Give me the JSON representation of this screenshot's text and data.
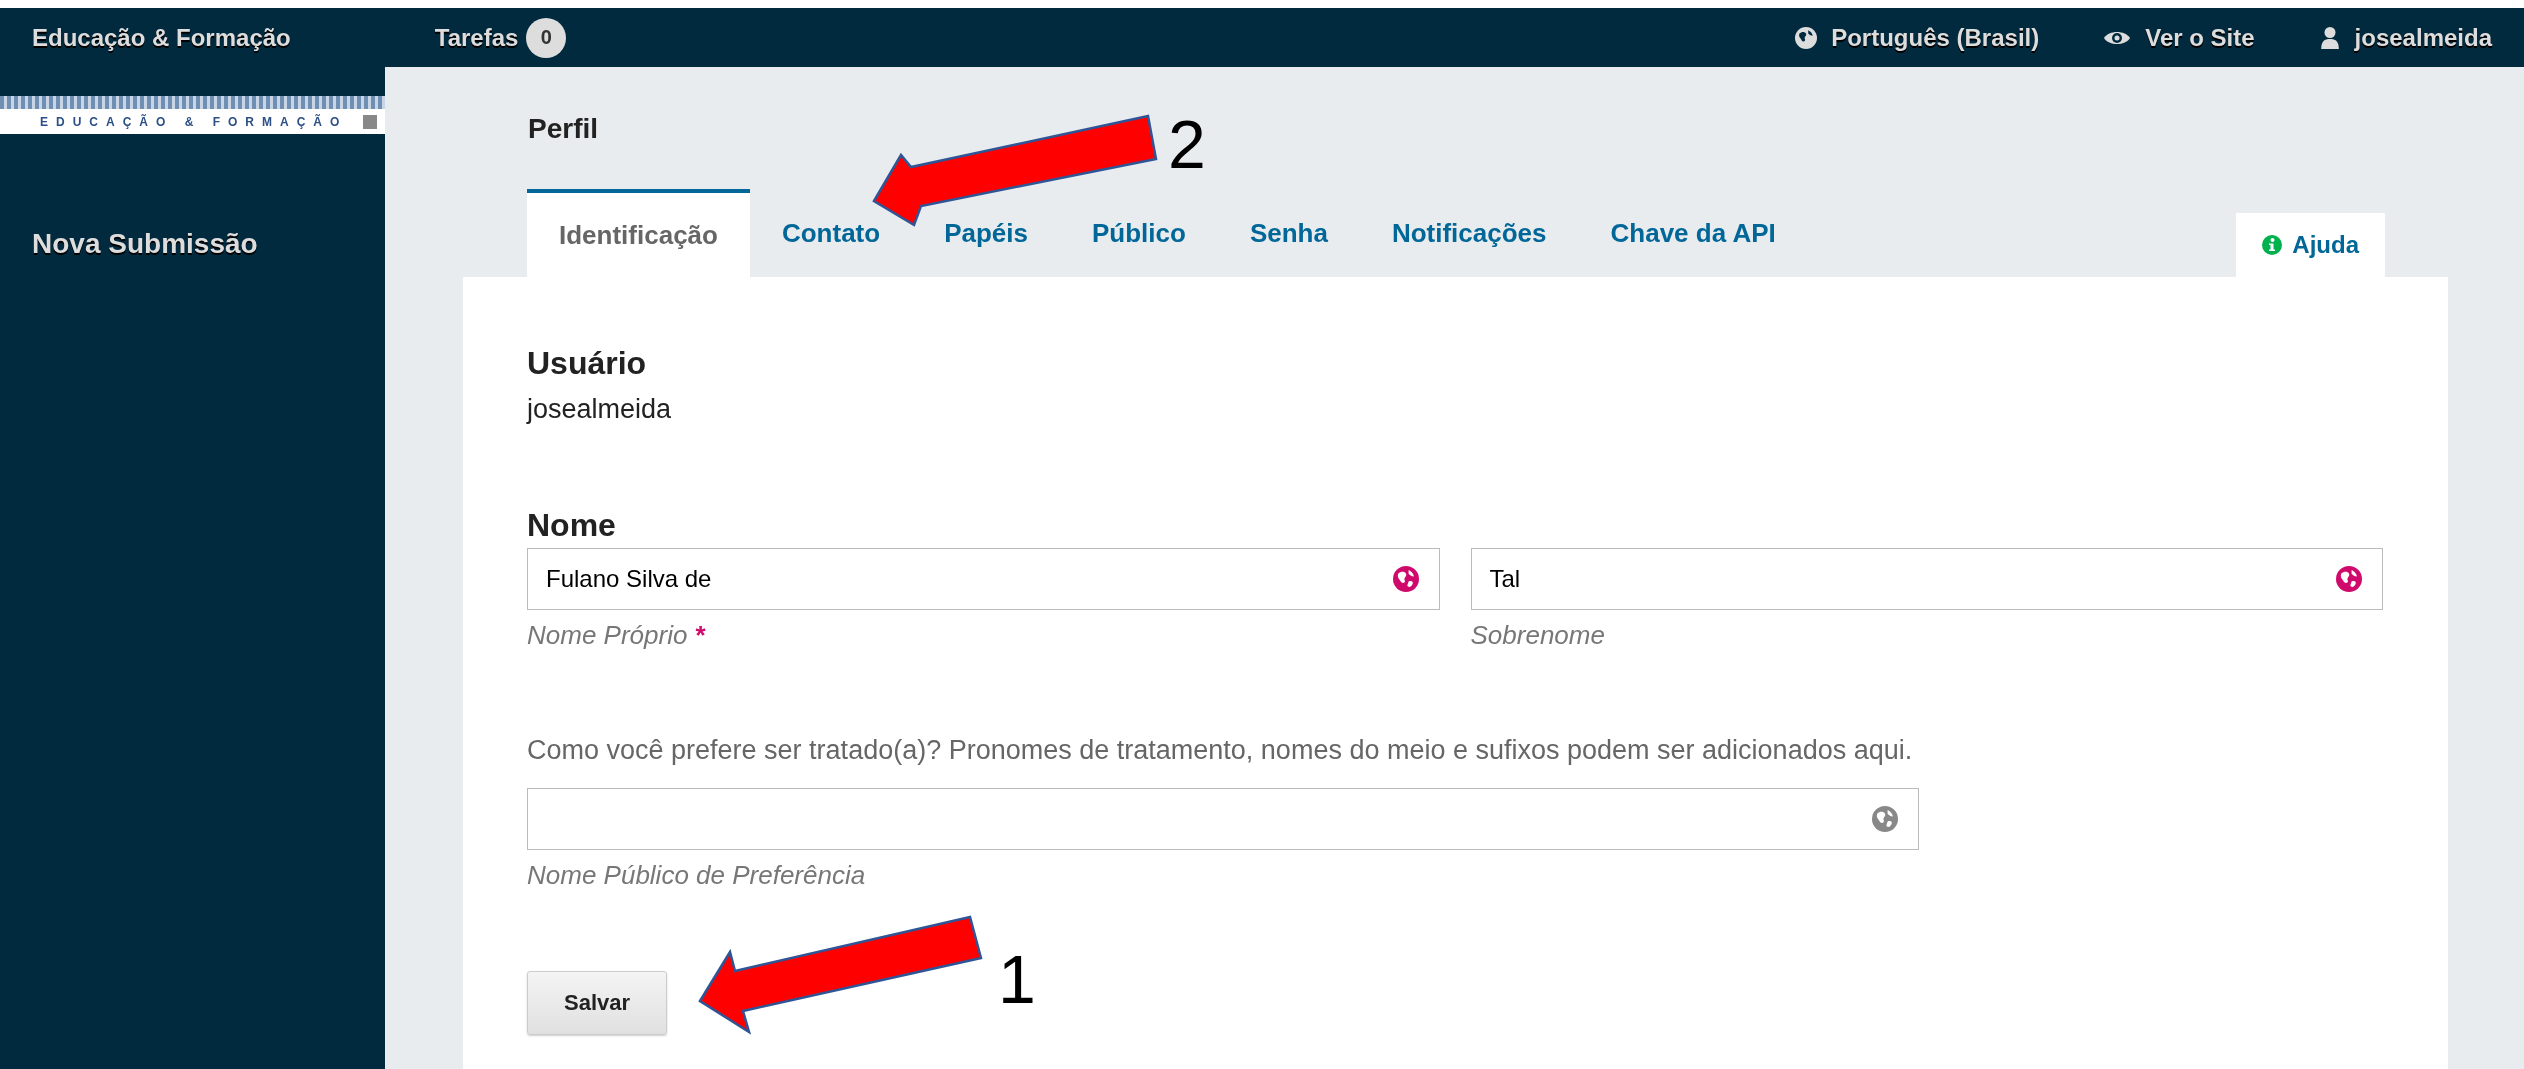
{
  "navbar": {
    "site_title": "Educação & Formação",
    "tasks": {
      "label": "Tarefas",
      "count": "0"
    },
    "language": "Português (Brasil)",
    "view_site": "Ver o Site",
    "user": "josealmeida"
  },
  "sidebar": {
    "logo_text": "EDUCAÇÃO & FORMAÇÃO",
    "items": [
      "Nova Submissão"
    ]
  },
  "page_title": "Perfil",
  "tabs": [
    {
      "label": "Identificação",
      "selected": true
    },
    {
      "label": "Contato",
      "selected": false
    },
    {
      "label": "Papéis",
      "selected": false
    },
    {
      "label": "Público",
      "selected": false
    },
    {
      "label": "Senha",
      "selected": false
    },
    {
      "label": "Notificações",
      "selected": false
    },
    {
      "label": "Chave da API",
      "selected": false
    }
  ],
  "help_tab": "Ajuda",
  "form": {
    "username": {
      "label": "Usuário",
      "value": "josealmeida"
    },
    "name": {
      "label": "Nome",
      "fields": [
        {
          "value": "Fulano Silva de",
          "sublabel": "Nome Próprio",
          "required_mark": "*"
        },
        {
          "value": "Tal",
          "sublabel": "Sobrenome"
        }
      ]
    },
    "preferred": {
      "description": "Como você prefere ser tratado(a)? Pronomes de tratamento, nomes do meio e sufixos podem ser adicionados aqui.",
      "sublabel": "Nome Público de Preferência"
    },
    "save_button": "Salvar"
  },
  "annotations": [
    {
      "number": "2"
    },
    {
      "number": "1"
    }
  ]
}
